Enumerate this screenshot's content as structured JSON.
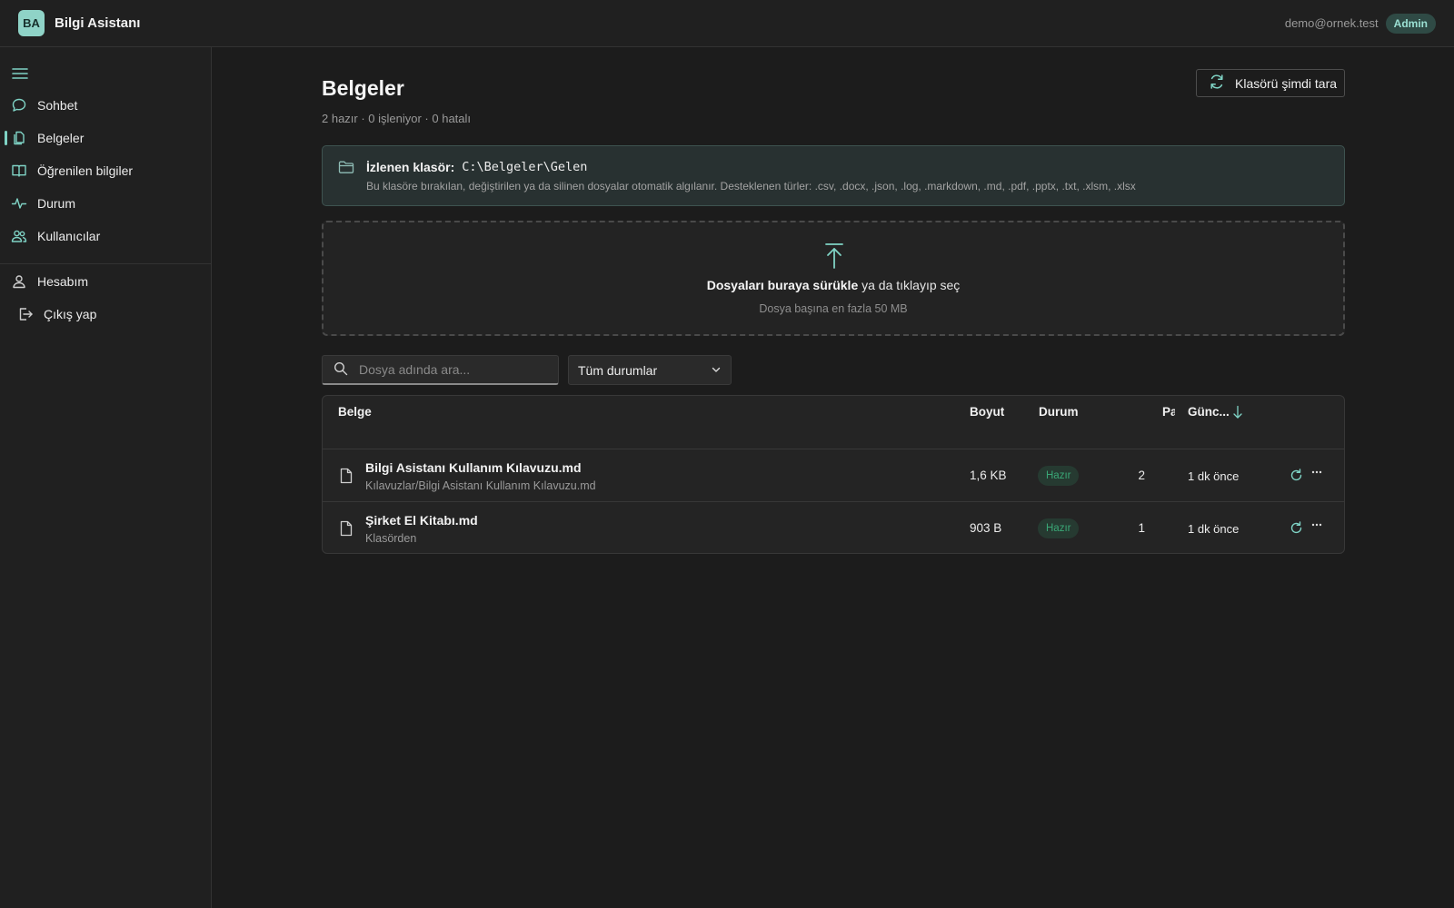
{
  "app": {
    "logo": "BA",
    "title": "Bilgi Asistanı"
  },
  "user": {
    "email": "demo@ornek.test",
    "role": "Admin"
  },
  "sidebar": {
    "items": [
      {
        "label": "Sohbet",
        "icon": "chat-icon"
      },
      {
        "label": "Belgeler",
        "icon": "document-icon",
        "active": true
      },
      {
        "label": "Öğrenilen bilgiler",
        "icon": "book-icon"
      },
      {
        "label": "Durum",
        "icon": "activity-icon"
      },
      {
        "label": "Kullanıcılar",
        "icon": "users-icon"
      }
    ],
    "account": [
      {
        "label": "Hesabım",
        "icon": "user-icon"
      },
      {
        "label": "Çıkış yap",
        "icon": "logout-icon"
      }
    ]
  },
  "page": {
    "title": "Belgeler",
    "summary": "2 hazır · 0 işleniyor · 0 hatalı",
    "scan_button": "Klasörü şimdi tara"
  },
  "watch": {
    "label": "İzlenen klasör:",
    "path": "C:\\Belgeler\\Gelen",
    "description": "Bu klasöre bırakılan, değiştirilen ya da silinen dosyalar otomatik algılanır. Desteklenen türler: .csv, .docx, .json, .log, .markdown, .md, .pdf, .pptx, .txt, .xlsm, .xlsx"
  },
  "upload": {
    "bold": "Dosyaları buraya sürükle",
    "rest": " ya da tıklayıp seç",
    "limit": "Dosya başına en fazla 50 MB"
  },
  "filters": {
    "search_placeholder": "Dosya adında ara...",
    "status_selected": "Tüm durumlar"
  },
  "table": {
    "headers": {
      "doc": "Belge",
      "size": "Boyut",
      "status": "Durum",
      "parts": "Par",
      "updated": "Günc..."
    },
    "rows": [
      {
        "name": "Bilgi Asistanı Kullanım Kılavuzu.md",
        "path": "Kılavuzlar/Bilgi Asistanı Kullanım Kılavuzu.md",
        "size": "1,6 KB",
        "status": "Hazır",
        "parts": "2",
        "updated": "1 dk önce"
      },
      {
        "name": "Şirket El Kitabı.md",
        "path": "Klasörden",
        "size": "903 B",
        "status": "Hazır",
        "parts": "1",
        "updated": "1 dk önce"
      }
    ]
  },
  "colors": {
    "accent": "#7fd3c5",
    "ready": "#3aa776",
    "background": "#1c1c1c"
  }
}
